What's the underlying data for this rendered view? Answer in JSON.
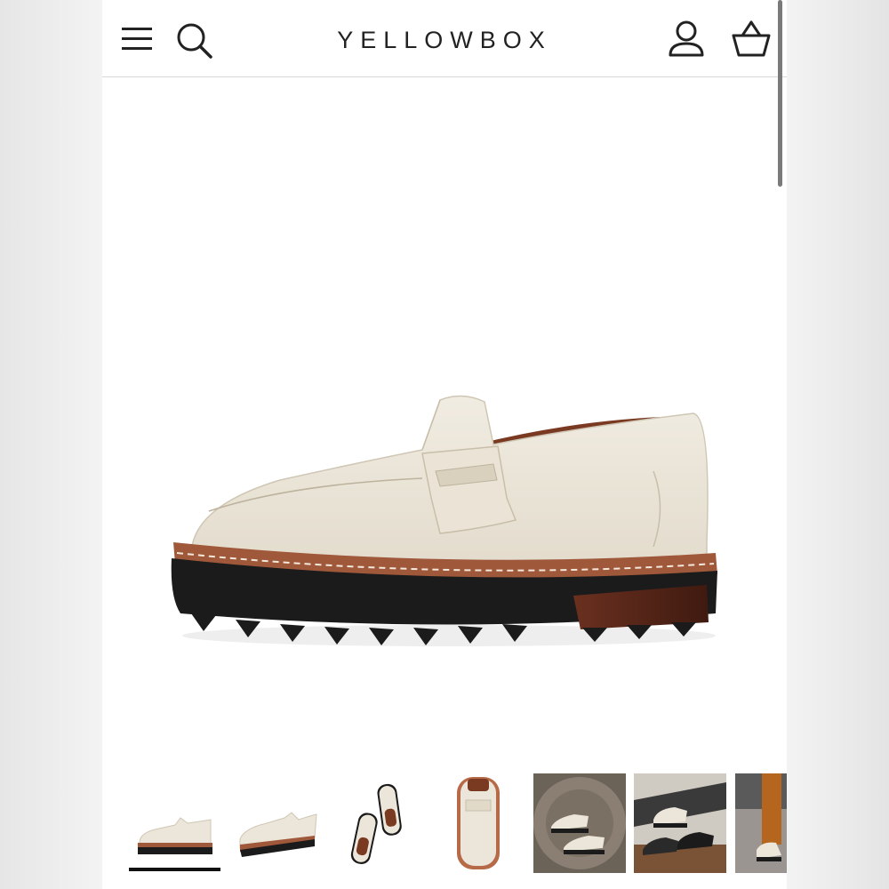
{
  "header": {
    "logo": "YELLOWBOX",
    "icons": [
      "menu-icon",
      "search-icon",
      "account-icon",
      "basket-icon"
    ]
  },
  "product": {
    "hero_image": "cream-penny-loafer-lug-sole-side-view",
    "thumbnails": [
      {
        "name": "thumbnail-side-view",
        "active": true
      },
      {
        "name": "thumbnail-angle-view",
        "active": false
      },
      {
        "name": "thumbnail-top-pair-view",
        "active": false
      },
      {
        "name": "thumbnail-closeup-top",
        "active": false
      },
      {
        "name": "thumbnail-lifestyle-barrel",
        "active": false
      },
      {
        "name": "thumbnail-lifestyle-bench",
        "active": false
      },
      {
        "name": "thumbnail-lifestyle-worn",
        "active": false
      }
    ]
  },
  "colors": {
    "shoe_cream": "#ece6da",
    "sole_black": "#1b1b1b",
    "welt_brown": "#a0583a",
    "heel_wood": "#5a2a1c"
  }
}
